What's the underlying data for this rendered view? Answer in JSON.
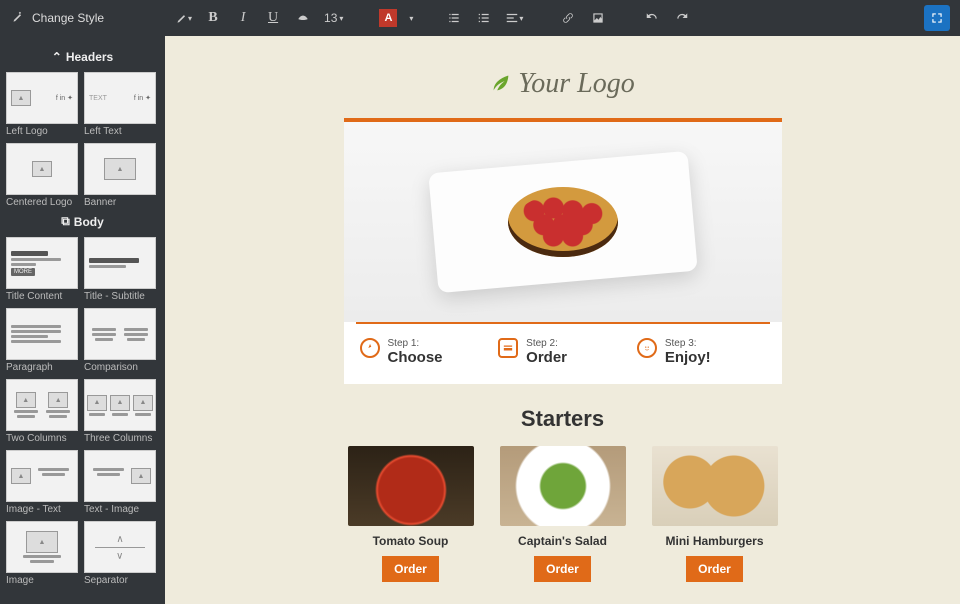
{
  "toolbar": {
    "change_style_label": "Change Style",
    "font_size": "13"
  },
  "sidebar": {
    "sections": [
      {
        "title": "Headers",
        "thumbs": [
          {
            "label": "Left Logo"
          },
          {
            "label": "Left Text"
          },
          {
            "label": "Centered Logo"
          },
          {
            "label": "Banner"
          }
        ]
      },
      {
        "title": "Body",
        "thumbs": [
          {
            "label": "Title Content"
          },
          {
            "label": "Title - Subtitle"
          },
          {
            "label": "Paragraph"
          },
          {
            "label": "Comparison"
          },
          {
            "label": "Two Columns"
          },
          {
            "label": "Three Columns"
          },
          {
            "label": "Image - Text"
          },
          {
            "label": "Text - Image"
          },
          {
            "label": "Image"
          },
          {
            "label": "Separator"
          }
        ]
      }
    ],
    "thumb_text_placeholder": "TEXT",
    "thumb_more_label": "MORE"
  },
  "template": {
    "logo_text": "Your Logo",
    "steps": [
      {
        "label": "Step 1:",
        "title": "Choose"
      },
      {
        "label": "Step 2:",
        "title": "Order"
      },
      {
        "label": "Step 3:",
        "title": "Enjoy!"
      }
    ],
    "starters_heading": "Starters",
    "items": [
      {
        "title": "Tomato Soup",
        "button": "Order"
      },
      {
        "title": "Captain's Salad",
        "button": "Order"
      },
      {
        "title": "Mini Hamburgers",
        "button": "Order"
      }
    ]
  }
}
